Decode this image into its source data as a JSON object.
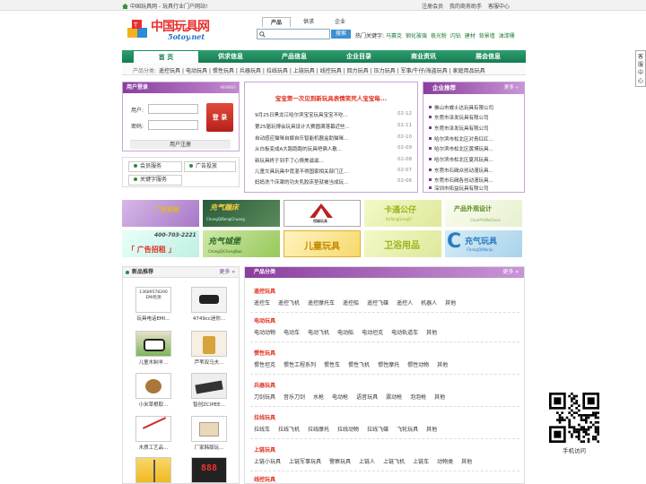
{
  "topbar": {
    "home_text": "中国玩具网 - 玩具行业门户网站!",
    "links": [
      "注册会员",
      "我的商务助手",
      "客服中心"
    ]
  },
  "logo": {
    "title": "中国玩具网",
    "subtitle": "5otoy.net"
  },
  "search": {
    "tabs": [
      "产品",
      "供求",
      "企业"
    ],
    "active_tab": "产品",
    "value": "",
    "button": "搜索",
    "hot_label": "热门关键字:",
    "hot_keywords": [
      "马赛克",
      "钢化玻璃",
      "夜光粉",
      "闪钻",
      "建材",
      "背景墙",
      "油漆桶"
    ]
  },
  "nav": {
    "items": [
      "首 页",
      "供求信息",
      "产品信息",
      "企业目录",
      "商业资讯",
      "展会信息"
    ],
    "active": "首 页"
  },
  "subnav": {
    "label": "产品分类:",
    "items": [
      "遥控玩具",
      "电动玩具",
      "惯性玩具",
      "兵器玩具",
      "拉线玩具",
      "上链玩具",
      "线控玩具",
      "回力玩具",
      "压力玩具",
      "军事/牛仔/海盗玩具",
      "家庭用品玩具"
    ]
  },
  "floatbar": {
    "text": "客服中心"
  },
  "login": {
    "title": "用户登录",
    "badge": "MEMBER",
    "user_label": "用户:",
    "pass_label": "密码:",
    "login_button": "登 录",
    "register_button": "用户注册",
    "services": [
      "会员服务",
      "广告投放",
      "关键字服务"
    ]
  },
  "news": {
    "headline": "宝宝第一次见到新玩具表情笑死人宝宝每...",
    "items": [
      {
        "title": "9月25日黑龙江哈尔滨宝宝玩具宝宝不吃...",
        "date": "02-12"
      },
      {
        "title": "第25届玩博会玩具设计大赛圆满落幕近些...",
        "date": "02-11"
      },
      {
        "title": "自动感应猫咪自娱自乐智能机器盒助猫咪...",
        "date": "02-10"
      },
      {
        "title": "从白板变成A大跑跑跑的玩具吧俩人散...",
        "date": "02-09"
      },
      {
        "title": "新玩具终于到手了心情美滋滋...",
        "date": "02-08"
      },
      {
        "title": "儿童文具玩具中竟混不得国家相关部门正...",
        "date": "02-07"
      },
      {
        "title": "妈妈洗个床罩的功夫乳胶床垫就被当成玩...",
        "date": "02-06"
      }
    ]
  },
  "company": {
    "title": "企业推荐",
    "more": "更多 »",
    "items": [
      "佛山市威士达玩具有限公司",
      "东莞市泽发玩具有限公司",
      "东莞市泽发玩具有限公司",
      "哈尔滨市松北区对青红红...",
      "哈尔滨市松北区黄博玩具...",
      "哈尔滨市松北区夏风玩具...",
      "东莞市石碣众创动漫玩具...",
      "东莞市石碣各创动漫玩具...",
      "深圳市拓益玩具有限公司"
    ]
  },
  "ads": {
    "row1": [
      "广告招租",
      "充气蹦床",
      "恒峰玩具",
      "卡通公仔",
      "产品外观设计"
    ],
    "row1_sub": [
      "",
      "ChongQiBengChuang",
      "",
      "KaTongGongZi",
      "ChanPinWaiGuan"
    ],
    "row2": [
      "400-703-2221",
      "充气城堡",
      "儿童玩具",
      "卫浴用品",
      "充气玩具"
    ],
    "row2_sub": [
      "「 广告招租 」",
      "ChongQiChengBao",
      "",
      "",
      "ChongQiWanJu"
    ]
  },
  "newprod": {
    "title": "新品推荐",
    "more": "更多 »",
    "items": [
      {
        "caption": "玩具电话EMI...",
        "img_text": "13689578290\nEMI检测"
      },
      {
        "caption": "4749cc迷你..."
      },
      {
        "caption": "儿童木制羊..."
      },
      {
        "caption": "芦苇双马夫..."
      },
      {
        "caption": "小米草根取..."
      },
      {
        "caption": "智创ZCIPEE..."
      },
      {
        "caption": "木质工艺品..."
      },
      {
        "caption": "厂家韩版玩..."
      },
      {
        "caption": ""
      },
      {
        "caption": "",
        "img_text": "888"
      }
    ]
  },
  "cats": {
    "title": "产品分类",
    "more": "更多 »",
    "groups": [
      {
        "name": "遥控玩具",
        "items": [
          "遥控车",
          "遥控飞机",
          "遥控摩托车",
          "遥控船",
          "遥控飞碟",
          "遥控人",
          "机器人",
          "其他"
        ]
      },
      {
        "name": "电动玩具",
        "items": [
          "电动动物",
          "电动车",
          "电动飞机",
          "电动船",
          "电动坦克",
          "电动轨道车",
          "其他"
        ]
      },
      {
        "name": "惯性玩具",
        "items": [
          "惯性坦克",
          "惯性工程系列",
          "惯性车",
          "惯性飞机",
          "惯性摩托",
          "惯性动物",
          "其他"
        ]
      },
      {
        "name": "兵器玩具",
        "items": [
          "刀剑玩具",
          "音乐刀剑",
          "水枪",
          "电动枪",
          "语音玩具",
          "震动枪",
          "泡泡枪",
          "其他"
        ]
      },
      {
        "name": "拉线玩具",
        "items": [
          "拉线车",
          "拉线飞机",
          "拉线摩托",
          "拉线动物",
          "拉线飞碟",
          "飞轮玩具",
          "其他"
        ]
      },
      {
        "name": "上链玩具",
        "items": [
          "上链小玩具",
          "上链军事玩具",
          "警察玩具",
          "上链人",
          "上链飞机",
          "上链车",
          "动物类",
          "其他"
        ]
      },
      {
        "name": "线控玩具",
        "items": []
      }
    ]
  },
  "qr": {
    "label": "手机访问"
  },
  "colors": {
    "nav_green": "#1b8b5a",
    "panel_purple": "#8a3e9e",
    "accent_red": "#e03020",
    "link_green": "#1c7a2e"
  }
}
